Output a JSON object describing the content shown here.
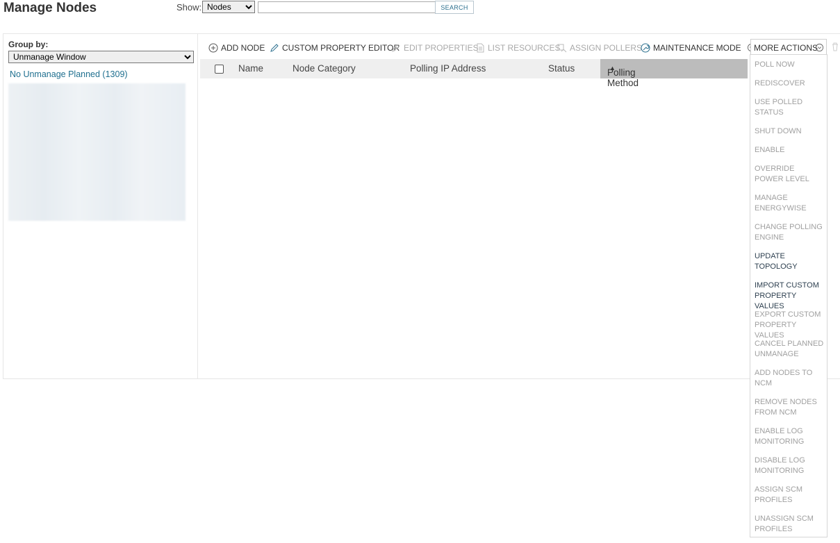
{
  "header": {
    "title": "Manage Nodes",
    "show_label": "Show:",
    "show_value": "Nodes",
    "search_value": "",
    "search_button": "SEARCH"
  },
  "left_pane": {
    "group_by_label": "Group by:",
    "group_by_value": "Unmanage Window",
    "groups": [
      {
        "label": "No Unmanage Planned (1309)"
      }
    ]
  },
  "toolbar": {
    "items": [
      {
        "label": "ADD NODE",
        "icon": "plus-circle-icon",
        "enabled": true
      },
      {
        "label": "CUSTOM PROPERTY EDITOR",
        "icon": "pencil-icon",
        "enabled": true
      },
      {
        "label": "EDIT PROPERTIES",
        "icon": "pencil-icon",
        "enabled": false
      },
      {
        "label": "LIST RESOURCES",
        "icon": "document-icon",
        "enabled": false
      },
      {
        "label": "ASSIGN POLLERS",
        "icon": "poller-icon",
        "enabled": false
      },
      {
        "label": "MAINTENANCE MODE",
        "icon": "wrench-circle-icon",
        "enabled": true
      }
    ],
    "more_actions": "MORE ACTIONS"
  },
  "grid": {
    "columns": [
      "Name",
      "Node Category",
      "Polling IP Address",
      "Status",
      "Polling Method"
    ],
    "sorted_column": "Polling Method",
    "sort_direction": "asc",
    "rows": []
  },
  "more_actions_menu": {
    "items": [
      {
        "label": "POLL NOW",
        "enabled": false
      },
      {
        "label": "REDISCOVER",
        "enabled": false
      },
      {
        "label": "USE POLLED STATUS",
        "enabled": false
      },
      {
        "label": "SHUT DOWN",
        "enabled": false
      },
      {
        "label": "ENABLE",
        "enabled": false
      },
      {
        "label": "OVERRIDE POWER LEVEL",
        "enabled": false
      },
      {
        "label": "MANAGE ENERGYWISE",
        "enabled": false
      },
      {
        "label": "CHANGE POLLING ENGINE",
        "enabled": false
      },
      {
        "label": "UPDATE TOPOLOGY",
        "enabled": true
      },
      {
        "label": "IMPORT CUSTOM PROPERTY VALUES",
        "enabled": true
      },
      {
        "label": "EXPORT CUSTOM PROPERTY VALUES",
        "enabled": false
      },
      {
        "label": "CANCEL PLANNED UNMANAGE",
        "enabled": false
      },
      {
        "label": "ADD NODES TO NCM",
        "enabled": false
      },
      {
        "label": "REMOVE NODES FROM NCM",
        "enabled": false
      },
      {
        "label": "ENABLE LOG MONITORING",
        "enabled": false
      },
      {
        "label": "DISABLE LOG MONITORING",
        "enabled": false
      },
      {
        "label": "ASSIGN SCM PROFILES",
        "enabled": false
      },
      {
        "label": "UNASSIGN SCM PROFILES",
        "enabled": false
      }
    ]
  },
  "colors": {
    "link": "#1f6f8f",
    "disabled_text": "#a0a0a0",
    "header_bg": "#efefef",
    "sorted_header_bg": "#bcbcbc"
  }
}
